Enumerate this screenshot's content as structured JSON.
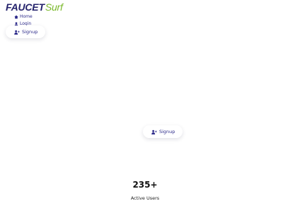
{
  "logo": {
    "main": "FAUCET",
    "accent": "Surf"
  },
  "nav": {
    "home_label": "Home",
    "login_label": "Login",
    "signup_label": "Signup"
  },
  "hero": {
    "signup_label": "Signup"
  },
  "stats": {
    "value": "235+",
    "label": "Active Users"
  },
  "colors": {
    "brand": "#23216b",
    "accent": "#7ab82a",
    "link": "#2c2a8a"
  },
  "icons": {
    "home": "home-icon",
    "login": "user-icon",
    "signup": "user-plus-icon"
  }
}
